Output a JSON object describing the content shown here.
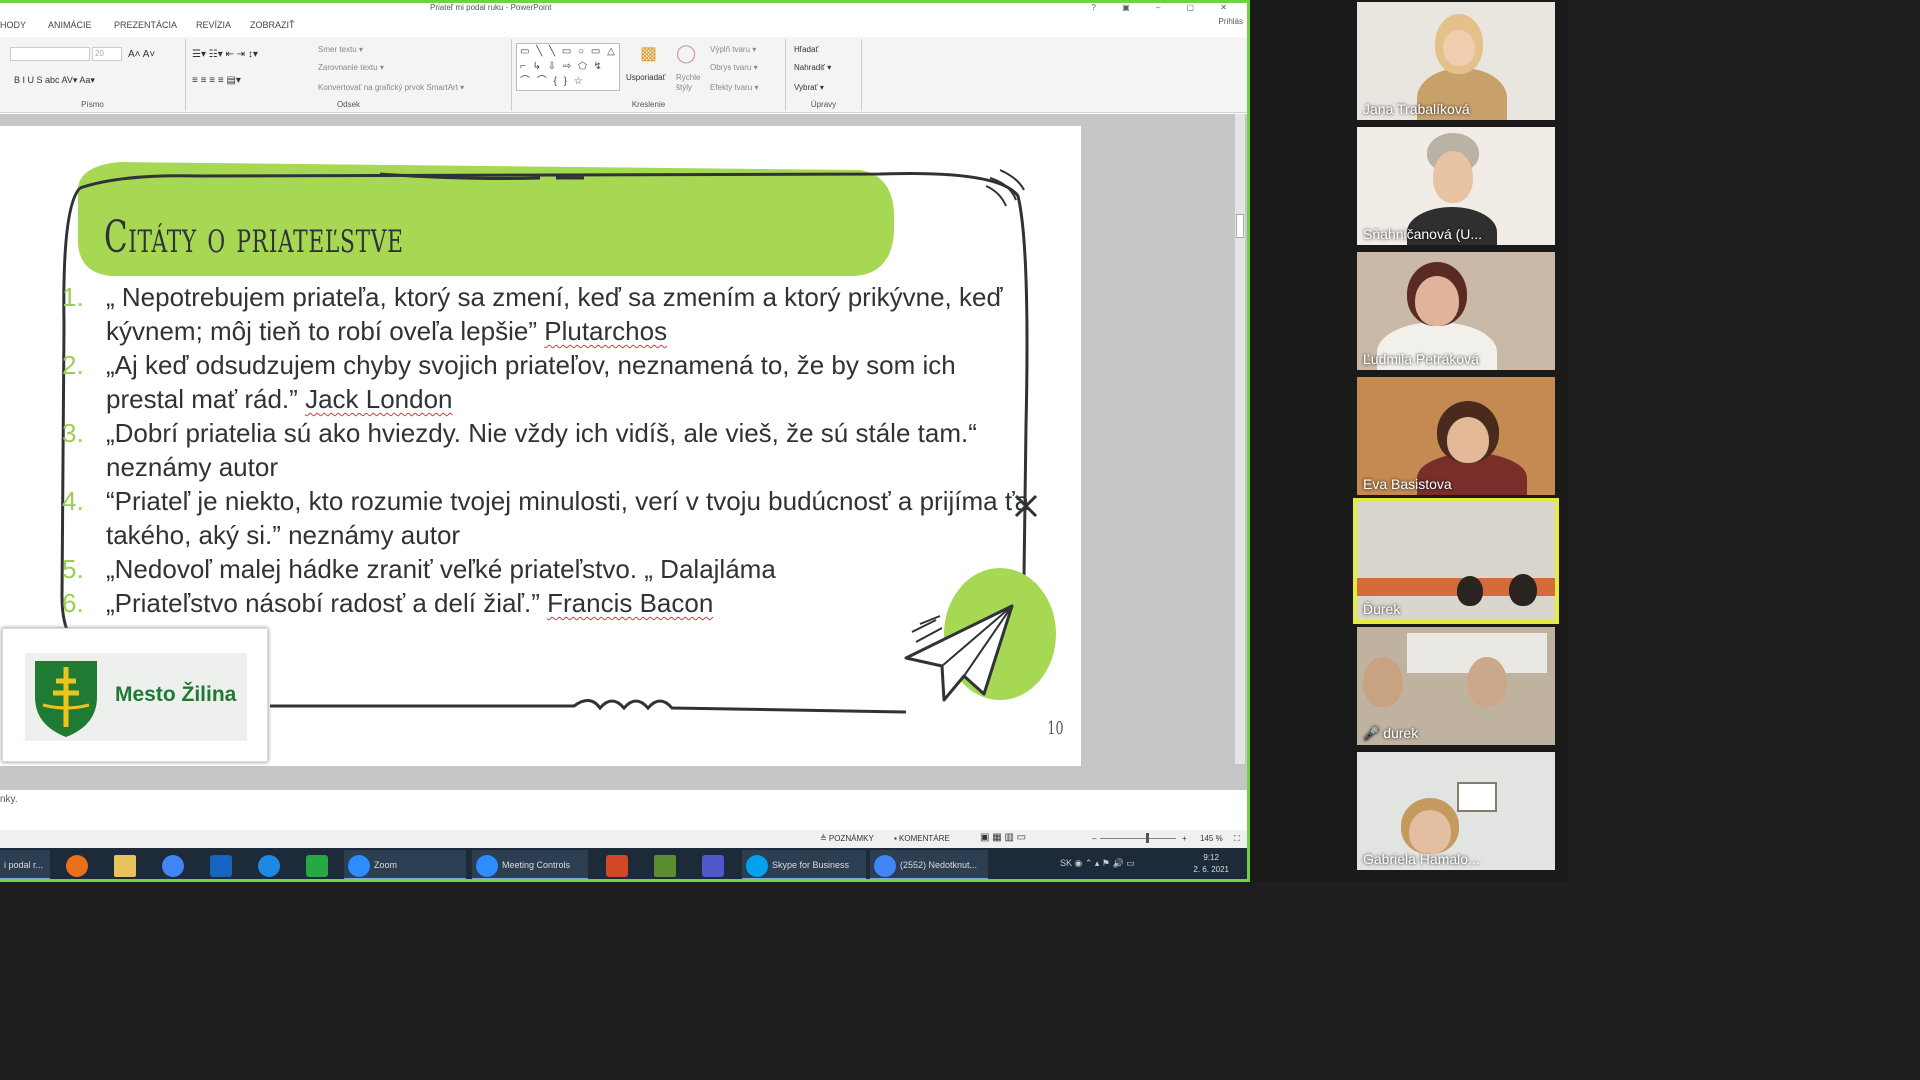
{
  "window": {
    "title": "Priateľ mi podal ruku - PowerPoint",
    "signin": "Prihlás",
    "controls": "? ▣ – ▢ ✕"
  },
  "ribbon": {
    "tabs": [
      "HODY",
      "ANIMÁCIE",
      "PREZENTÁCIA",
      "REVÍZIA",
      "ZOBRAZIŤ"
    ],
    "font_size": "20",
    "font_group": "Písmo",
    "font_buttons": "B  I  U  S  abc  AV▾  Aa▾",
    "paragraph_group": "Odsek",
    "text_direction": "Smer textu ▾",
    "align_text": "Zarovnanie textu ▾",
    "smartart": "Konvertovať na grafický prvok SmartArt ▾",
    "shapes": "▭ ╲ ╲ ▭ ○ ▭ △ ⌐ ↳ ⇩ ⇨ ⬠ ↯ ⌒ ⌒ { } ☆",
    "arrange": "Usporiadať",
    "quick_styles": "Rýchle štýly",
    "shape_fill": "Výplň tvaru ▾",
    "shape_outline": "Obrys tvaru ▾",
    "shape_effects": "Efekty tvaru ▾",
    "drawing_group": "Kreslenie",
    "find": "Hľadať",
    "replace": "Nahradiť ▾",
    "select": "Vybrať ▾",
    "editing_group": "Úpravy"
  },
  "slide": {
    "title": "Citáty o priateľstve",
    "quotes": [
      {
        "num": "1.",
        "text": "„ Nepotrebujem priateľa, ktorý sa zmení, keď sa zmením a ktorý prikývne, keď kývnem; môj tieň to robí oveľa lepšie”",
        "author": "Plutarchos"
      },
      {
        "num": "2.",
        "text": "„Aj keď odsudzujem chyby svojich priateľov, neznamená to, že by som ich prestal mať rád.”",
        "author": "Jack London"
      },
      {
        "num": "3.",
        "text": "„Dobrí priatelia sú ako hviezdy. Nie vždy ich vidíš, ale vieš, že sú stále tam.“ neznámy autor",
        "author": ""
      },
      {
        "num": "4.",
        "text": "“Priateľ je niekto, kto rozumie tvojej minulosti, verí v tvoju budúcnosť a prijíma ťa takého, aký si.” neznámy autor",
        "author": ""
      },
      {
        "num": "5.",
        "text": "„Nedovoľ malej hádke zraniť veľké priateľstvo. „ Dalajláma",
        "author": ""
      },
      {
        "num": "6.",
        "text": "„Priateľstvo násobí radosť a delí žiaľ.”",
        "author": "Francis Bacon"
      }
    ],
    "slide_number": "10",
    "logo_text": "Mesto Žilina"
  },
  "notes_text": "nky.",
  "status": {
    "notes": "≜ POZNÁMKY",
    "comments": "▪ KOMENTÁRE",
    "zoom": "145 %"
  },
  "taskbar": {
    "items": [
      {
        "label": "i podal r...",
        "color": "#c0392b"
      },
      {
        "label": "",
        "color": "#e8701a"
      },
      {
        "label": "",
        "color": "#e8c25a"
      },
      {
        "label": "",
        "color": "#4285f4"
      },
      {
        "label": "",
        "color": "#1565c0"
      },
      {
        "label": "",
        "color": "#1e88e5"
      },
      {
        "label": "",
        "color": "#28a745"
      },
      {
        "label": "Zoom",
        "color": "#2d8cff"
      },
      {
        "label": "Meeting Controls",
        "color": "#2d8cff"
      },
      {
        "label": "",
        "color": "#d24726"
      },
      {
        "label": "",
        "color": "#5b8c32"
      },
      {
        "label": "",
        "color": "#5059c9"
      },
      {
        "label": "Skype for Business",
        "color": "#00a2ed"
      },
      {
        "label": "(2552) Nedotknut...",
        "color": "#4285f4"
      }
    ],
    "lang": "SK",
    "time": "9:12",
    "date": "2. 6. 2021"
  },
  "participants": [
    {
      "name": "Jana Trabalíková",
      "bg": "#e9e6df",
      "muted": false,
      "active": false
    },
    {
      "name": "Sňahničanová (U...",
      "bg": "#f1ede6",
      "muted": false,
      "active": false
    },
    {
      "name": "Ľudmila Petráková",
      "bg": "#c9b9a6",
      "muted": false,
      "active": false
    },
    {
      "name": "Eva Basistova",
      "bg": "#c48a52",
      "muted": false,
      "active": false
    },
    {
      "name": "Ďurek",
      "bg": "#d9d6cd",
      "muted": false,
      "active": true
    },
    {
      "name": "durek",
      "bg": "#bfb3a0",
      "muted": true,
      "active": false
    },
    {
      "name": "Gabriela Hamalo...",
      "bg": "#e2e4e2",
      "muted": false,
      "active": false
    }
  ],
  "colors": {
    "accent_green": "#9ccf4e",
    "title_bar_green": "#a6d854",
    "zoom_frame": "#6ed43c",
    "active_speaker": "#e6eb3c"
  }
}
